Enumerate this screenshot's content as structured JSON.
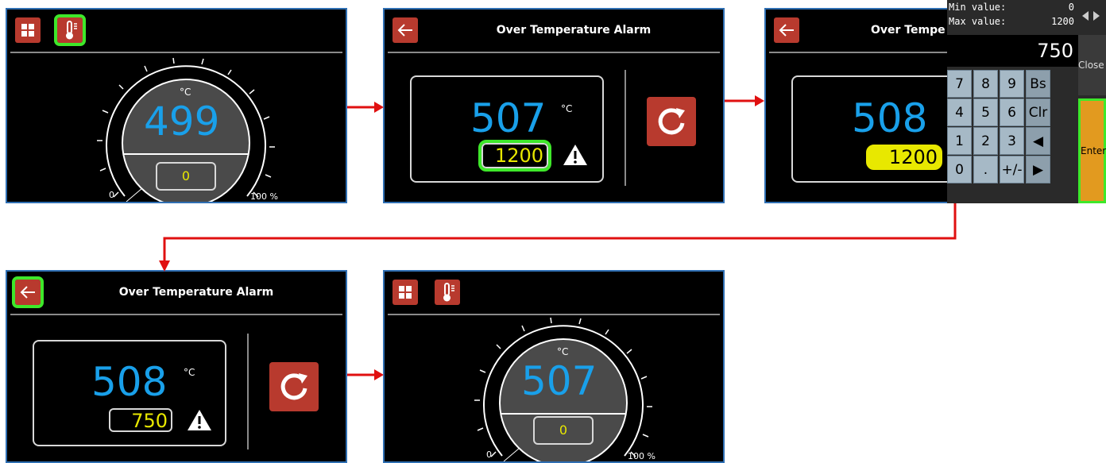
{
  "screens": [
    {
      "id": "home_before",
      "gauge": {
        "unit": "°C",
        "value": "499",
        "setpoint": "0",
        "min_label": "0",
        "max_label": "100 %"
      }
    },
    {
      "id": "alarm_edit",
      "title": "Over Temperature Alarm",
      "value": "507",
      "unit": "°C",
      "alarm_setpoint": "1200"
    },
    {
      "id": "alarm_keypad",
      "title": "Over Tempe",
      "value": "508",
      "alarm_setpoint": "1200",
      "keypad": {
        "min_label": "Min value:",
        "min_value": "0",
        "max_label": "Max value:",
        "max_value": "1200",
        "display": "750",
        "close_label": "Close",
        "enter_label": "Enter",
        "keys": [
          "7",
          "8",
          "9",
          "Bs",
          "4",
          "5",
          "6",
          "Clr",
          "1",
          "2",
          "3",
          "◀",
          "0",
          ".",
          "+/-",
          "▶"
        ]
      }
    },
    {
      "id": "alarm_after",
      "title": "Over Temperature Alarm",
      "value": "508",
      "unit": "°C",
      "alarm_setpoint": "750"
    },
    {
      "id": "home_after",
      "gauge": {
        "unit": "°C",
        "value": "507",
        "setpoint": "0",
        "min_label": "0",
        "max_label": "100 %"
      }
    }
  ],
  "colors": {
    "accent_red": "#b83a2e",
    "highlight_green": "#3ee82a",
    "value_blue": "#19a0ea",
    "setpoint_yellow": "#e8e800",
    "flow_arrow": "#e01010"
  },
  "icons": [
    "grid-icon",
    "thermometer-icon",
    "back-arrow-icon",
    "reset-icon",
    "warning-icon"
  ]
}
